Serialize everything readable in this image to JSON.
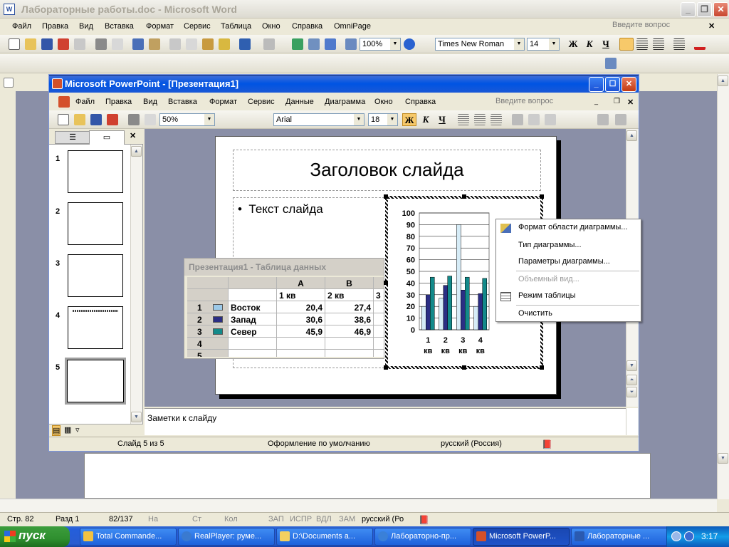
{
  "word": {
    "title": "Лабораторные работы.doc - Microsoft Word",
    "menu": [
      "Файл",
      "Правка",
      "Вид",
      "Вставка",
      "Формат",
      "Сервис",
      "Таблица",
      "Окно",
      "Справка",
      "OmniPage"
    ],
    "ask_placeholder": "Введите вопрос",
    "zoom": "100%",
    "font": "Times New Roman",
    "font_size": "14",
    "bold": "Ж",
    "italic": "К",
    "underline": "Ч",
    "status": {
      "page": "Стр. 82",
      "section": "Разд 1",
      "pages": "82/137",
      "at": "На",
      "line": "Ст",
      "col": "Кол",
      "rec": "ЗАП",
      "trk": "ИСПР",
      "ext": "ВДЛ",
      "ovr": "ЗАМ",
      "lang": "русский (Ро"
    }
  },
  "ppt": {
    "title": "Microsoft PowerPoint - [Презентация1]",
    "menu": [
      "Файл",
      "Правка",
      "Вид",
      "Вставка",
      "Формат",
      "Сервис",
      "Данные",
      "Диаграмма",
      "Окно",
      "Справка"
    ],
    "ask_placeholder": "Введите вопрос",
    "zoom": "50%",
    "font": "Arial",
    "font_size": "18",
    "bold": "Ж",
    "italic": "К",
    "underline": "Ч",
    "slides": [
      "1",
      "2",
      "3",
      "4",
      "5"
    ],
    "slide_title": "Заголовок слайда",
    "slide_text": "Текст слайда",
    "notes": "Заметки к слайду",
    "status": {
      "slide": "Слайд 5 из 5",
      "design": "Оформление по умолчанию",
      "lang": "русский (Россия)"
    }
  },
  "datasheet": {
    "title": "Презентация1 - Таблица данных",
    "col_letters": [
      "A",
      "B"
    ],
    "col_headers": [
      "1 кв",
      "2 кв",
      "3"
    ],
    "rows": [
      {
        "num": "1",
        "name": "Восток",
        "a": "20,4",
        "b": "27,4",
        "color": "#9cc9e8"
      },
      {
        "num": "2",
        "name": "Запад",
        "a": "30,6",
        "b": "38,6",
        "color": "#2b2e84"
      },
      {
        "num": "3",
        "name": "Север",
        "a": "45,9",
        "b": "46,9",
        "color": "#138a8a"
      }
    ],
    "empty_rows": [
      "4",
      "5"
    ]
  },
  "context_menu": {
    "items": [
      {
        "label": "Формат области диаграммы...",
        "enabled": true,
        "icon": "format-chart-area-icon"
      },
      {
        "label": "Тип диаграммы...",
        "enabled": true,
        "icon": ""
      },
      {
        "label": "Параметры диаграммы...",
        "enabled": true,
        "icon": ""
      },
      {
        "label": "Объемный вид...",
        "enabled": false,
        "icon": ""
      },
      {
        "label": "Режим таблицы",
        "enabled": true,
        "icon": "datasheet-icon"
      },
      {
        "label": "Очистить",
        "enabled": true,
        "icon": ""
      }
    ]
  },
  "chart_data": {
    "type": "bar",
    "categories": [
      "1 кв",
      "2 кв",
      "3 кв",
      "4 кв"
    ],
    "series": [
      {
        "values": [
          20,
          27,
          90,
          20
        ],
        "color": "#d6ecf7"
      },
      {
        "values": [
          30,
          38,
          34,
          31
        ],
        "color": "#2b2e84"
      },
      {
        "values": [
          45,
          46,
          45,
          44
        ],
        "color": "#138a8a"
      }
    ],
    "ylim": [
      0,
      100
    ],
    "yticks": [
      "100",
      "90",
      "80",
      "70",
      "60",
      "50",
      "40",
      "30",
      "20",
      "10",
      "0"
    ],
    "grid": true
  },
  "taskbar": {
    "start": "пуск",
    "tasks": [
      "Total Commande...",
      "RealPlayer: руме...",
      "D:\\Documents a...",
      "Лабораторно-пр...",
      "Microsoft PowerP...",
      "Лабораторные ..."
    ],
    "clock": "3:17"
  }
}
